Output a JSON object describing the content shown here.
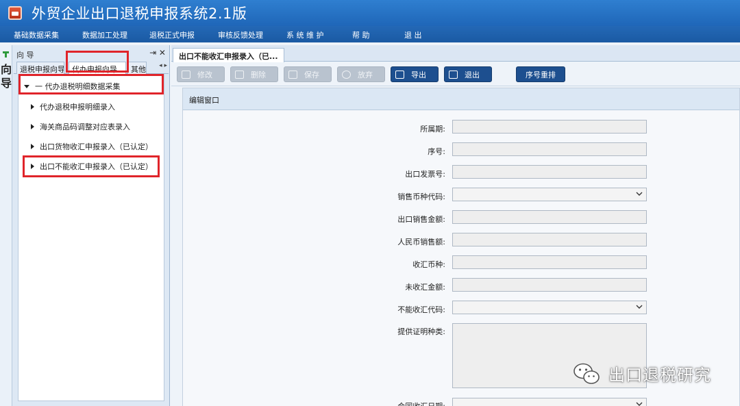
{
  "app": {
    "title": "外贸企业出口退税申报系统2.1版",
    "icon": "app-logo-icon"
  },
  "menu": [
    "基础数据采集",
    "数据加工处理",
    "退税正式申报",
    "审核反馈处理",
    "系 统 维 护",
    "帮    助",
    "退    出"
  ],
  "nav": {
    "side_label": "向导",
    "header_title": "向 导",
    "header_buttons": "⇥ ✕",
    "tabs": [
      "退税申报向导",
      "代办申报向导",
      "其他"
    ],
    "active_tab": "代办申报向导",
    "tree": [
      {
        "label": "一 代办退税明细数据采集",
        "expanded": true
      },
      {
        "label": "代办退税申报明细录入",
        "expanded": false
      },
      {
        "label": "海关商品码调整对应表录入",
        "expanded": false
      },
      {
        "label": "出口货物收汇申报录入（已认定）",
        "expanded": false
      },
      {
        "label": "出口不能收汇申报录入（已认定）",
        "expanded": false
      }
    ]
  },
  "document": {
    "tab_title": "出口不能收汇申报录入（已...",
    "toolbar": [
      {
        "label": "修改",
        "icon": "edit-icon",
        "enabled": false
      },
      {
        "label": "删除",
        "icon": "delete-icon",
        "enabled": false
      },
      {
        "label": "保存",
        "icon": "save-icon",
        "enabled": false
      },
      {
        "label": "放弃",
        "icon": "cancel-icon",
        "enabled": false
      },
      {
        "label": "导出",
        "icon": "export-icon",
        "enabled": true
      },
      {
        "label": "退出",
        "icon": "exit-icon",
        "enabled": true
      },
      {
        "label": "序号重排",
        "icon": "",
        "enabled": true
      }
    ],
    "edit_window_title": "编辑窗口",
    "fields": [
      {
        "label": "所属期:",
        "type": "input",
        "value": ""
      },
      {
        "label": "序号:",
        "type": "input",
        "value": ""
      },
      {
        "label": "出口发票号:",
        "type": "input",
        "value": ""
      },
      {
        "label": "销售币种代码:",
        "type": "select",
        "value": ""
      },
      {
        "label": "出口销售金额:",
        "type": "input",
        "value": ""
      },
      {
        "label": "人民币销售额:",
        "type": "input",
        "value": ""
      },
      {
        "label": "收汇币种:",
        "type": "input",
        "value": ""
      },
      {
        "label": "未收汇金额:",
        "type": "input",
        "value": ""
      },
      {
        "label": "不能收汇代码:",
        "type": "select",
        "value": ""
      },
      {
        "label": "提供证明种类:",
        "type": "textarea",
        "value": ""
      },
      {
        "label": "合同收汇日期:",
        "type": "select",
        "value": ""
      }
    ]
  },
  "watermark": {
    "text": "出口退税研究",
    "icon": "wechat-icon"
  },
  "colors": {
    "titlebar": "#2f7fd0",
    "menubar": "#1f5fa8",
    "highlight_box": "#e0242a",
    "enabled_button": "#1d4f8f",
    "disabled_button": "#b9c3cf"
  }
}
